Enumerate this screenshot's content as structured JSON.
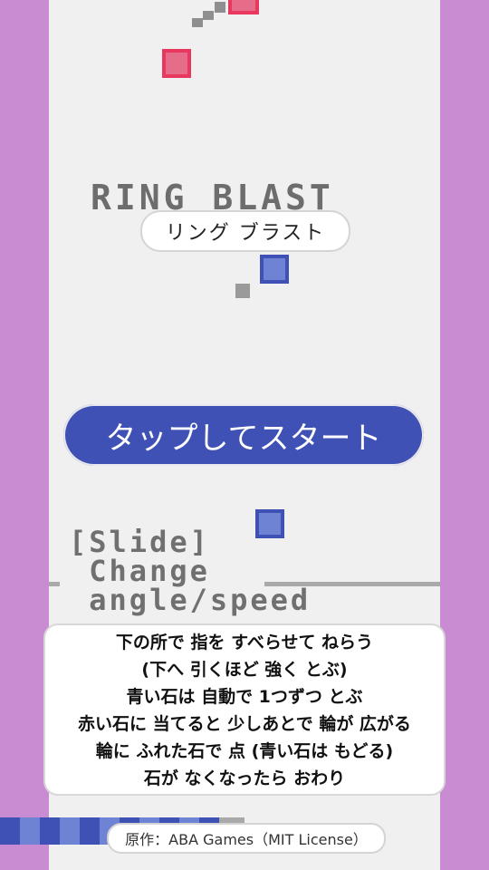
{
  "title": {
    "pixel_text": "RING BLAST",
    "subtitle": "リング ブラスト"
  },
  "start_button": {
    "label": "タップしてスタート"
  },
  "pixel_instructions": {
    "line1": "[Slide]",
    "line2": " Change",
    "line3": " angle/speed"
  },
  "instructions": {
    "lines": [
      "下の所で 指を すべらせて ねらう",
      "(下へ 引くほど 強く とぶ)",
      "青い石は 自動で 1つずつ とぶ",
      "赤い石に 当てると 少しあとで 輪が 広がる",
      "輪に ふれた石で 点 (青い石は もどる)",
      "石が なくなったら おわり"
    ]
  },
  "credit": {
    "text": "原作：ABA Games（MIT License）"
  },
  "colors": {
    "wall": "#c98bd1",
    "background": "#f0f0f0",
    "red_stone": "#e8385f",
    "blue_stone": "#3f51b5",
    "button": "#3f51b5"
  }
}
